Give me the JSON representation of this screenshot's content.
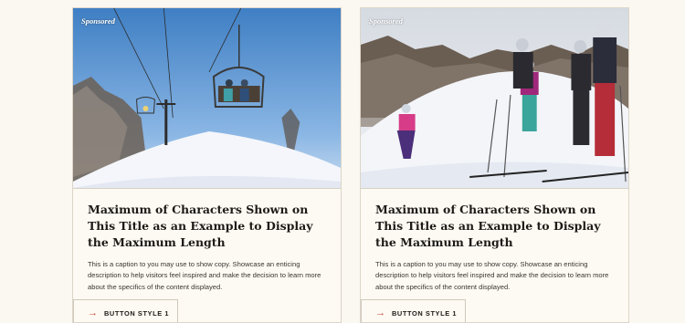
{
  "cards": [
    {
      "badge": "Sponsored",
      "title": "Maximum of Characters Shown on This Title as an Example to Display the Maximum Length",
      "caption": "This is a caption to you may use to show copy. Showcase an enticing description to help visitors feel inspired and make the decision to learn more about the specifics of the content displayed.",
      "button_label": "BUTTON STYLE 1",
      "button_icon": "arrow-right-icon",
      "image": "chairlift-photo"
    },
    {
      "badge": "Sponsored",
      "title": "Maximum of Characters Shown on This Title as an Example to Display the Maximum Length",
      "caption": "This is a caption to you may use to show copy. Showcase an enticing description to help visitors feel inspired and make the decision to learn more about the specifics of the content displayed.",
      "button_label": "BUTTON STYLE 1",
      "button_icon": "arrow-right-icon",
      "image": "family-skiers-photo"
    }
  ],
  "colors": {
    "background": "#fbf8f1",
    "card": "#fdfaf3",
    "accent_arrow": "#c8442d",
    "text": "#1d1a17"
  }
}
